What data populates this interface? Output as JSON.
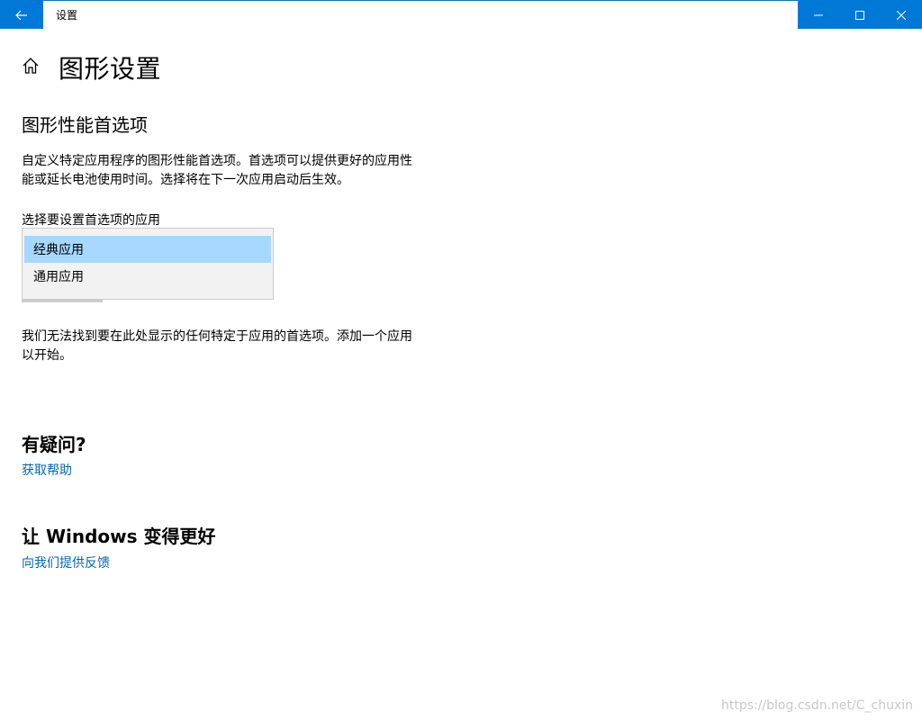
{
  "window": {
    "title": "设置"
  },
  "page": {
    "title": "图形设置"
  },
  "section": {
    "title": "图形性能首选项",
    "description": "自定义特定应用程序的图形性能首选项。首选项可以提供更好的应用性能或延长电池使用时间。选择将在下一次应用启动后生效。"
  },
  "app_select": {
    "label": "选择要设置首选项的应用",
    "options": [
      "经典应用",
      "通用应用"
    ],
    "selected": "经典应用"
  },
  "empty_message": "我们无法找到要在此处显示的任何特定于应用的首选项。添加一个应用以开始。",
  "questions": {
    "title": "有疑问?",
    "link": "获取帮助"
  },
  "improve": {
    "title": "让 Windows 变得更好",
    "link": "向我们提供反馈"
  },
  "watermark": "https://blog.csdn.net/C_chuxin",
  "colors": {
    "accent": "#0078d7",
    "link": "#0067b8",
    "selected_option": "#a6d8ff"
  }
}
